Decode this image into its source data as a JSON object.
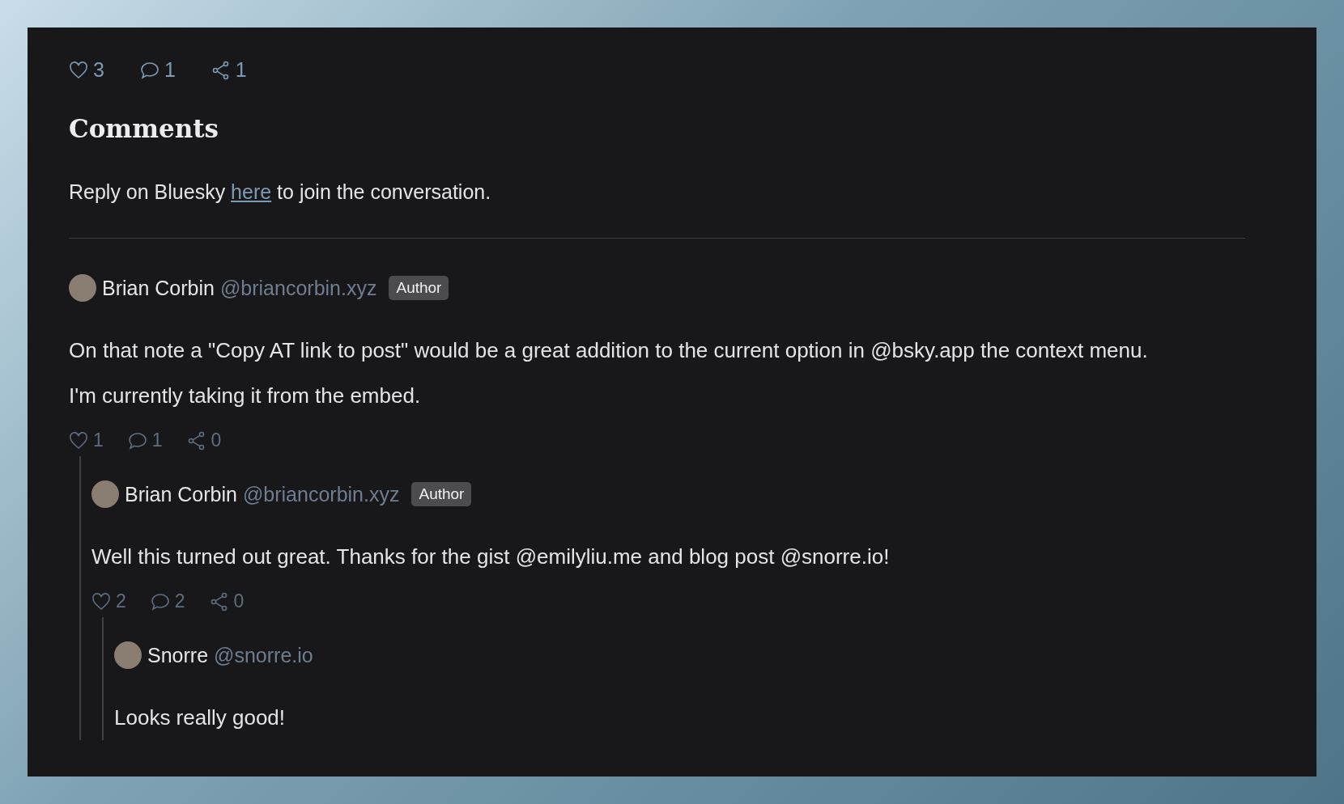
{
  "post_stats": {
    "likes": "3",
    "replies": "1",
    "reposts": "1"
  },
  "heading": "Comments",
  "reply_prompt": {
    "before": "Reply on Bluesky",
    "link": "here",
    "after": "to join the conversation."
  },
  "comments": [
    {
      "name": "Brian Corbin",
      "handle": "@briancorbin.xyz",
      "badge": "Author",
      "body": [
        "On that note a \"Copy AT link to post\" would be a great addition to the current option in @bsky.app the context menu.",
        "I'm currently taking it from the embed."
      ],
      "stats": {
        "likes": "1",
        "replies": "1",
        "reposts": "0"
      },
      "children": [
        {
          "name": "Brian Corbin",
          "handle": "@briancorbin.xyz",
          "badge": "Author",
          "body": [
            "Well this turned out great. Thanks for the gist @emilyliu.me and blog post @snorre.io!"
          ],
          "stats": {
            "likes": "2",
            "replies": "2",
            "reposts": "0"
          },
          "children": [
            {
              "name": "Snorre",
              "handle": "@snorre.io",
              "body": [
                "Looks really good!"
              ]
            }
          ]
        }
      ]
    }
  ]
}
